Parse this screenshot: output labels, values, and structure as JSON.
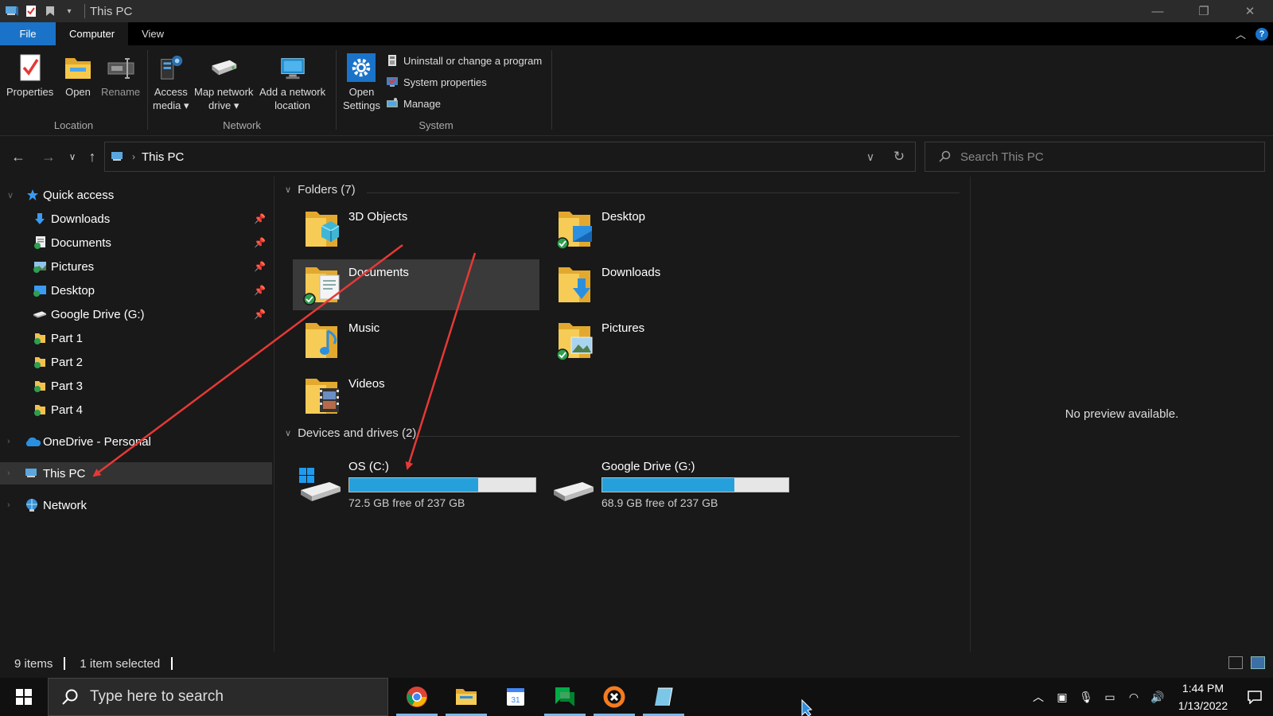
{
  "window": {
    "title": "This PC"
  },
  "ribbon_tabs": [
    {
      "label": "File"
    },
    {
      "label": "Computer"
    },
    {
      "label": "View"
    }
  ],
  "ribbon": {
    "location": {
      "label": "Location",
      "properties": "Properties",
      "open": "Open",
      "rename": "Rename"
    },
    "network": {
      "label": "Network",
      "access_media_1": "Access",
      "access_media_2": "media",
      "map_drive_1": "Map network",
      "map_drive_2": "drive",
      "add_location_1": "Add a network",
      "add_location_2": "location"
    },
    "system": {
      "label": "System",
      "open_settings_1": "Open",
      "open_settings_2": "Settings",
      "uninstall": "Uninstall or change a program",
      "system_properties": "System properties",
      "manage": "Manage"
    }
  },
  "address": {
    "crumb": "This PC",
    "search_placeholder": "Search This PC"
  },
  "nav_pane": {
    "quick_access": "Quick access",
    "quick_items": [
      {
        "label": "Downloads",
        "pinned": true
      },
      {
        "label": "Documents",
        "pinned": true
      },
      {
        "label": "Pictures",
        "pinned": true
      },
      {
        "label": "Desktop",
        "pinned": true
      },
      {
        "label": "Google Drive (G:)",
        "pinned": true
      },
      {
        "label": "Part 1",
        "pinned": false
      },
      {
        "label": "Part 2",
        "pinned": false
      },
      {
        "label": "Part 3",
        "pinned": false
      },
      {
        "label": "Part 4",
        "pinned": false
      }
    ],
    "onedrive": "OneDrive - Personal",
    "this_pc": "This PC",
    "network": "Network"
  },
  "content": {
    "folders_header": "Folders (7)",
    "folders": [
      {
        "label": "3D Objects"
      },
      {
        "label": "Desktop"
      },
      {
        "label": "Documents"
      },
      {
        "label": "Downloads"
      },
      {
        "label": "Music"
      },
      {
        "label": "Pictures"
      },
      {
        "label": "Videos"
      }
    ],
    "drives_header": "Devices and drives (2)",
    "drives": [
      {
        "name": "OS (C:)",
        "free": "72.5 GB free of 237 GB",
        "used_fraction": 0.694
      },
      {
        "name": "Google Drive (G:)",
        "free": "68.9 GB free of 237 GB",
        "used_fraction": 0.709
      }
    ]
  },
  "preview": {
    "text": "No preview available."
  },
  "status": {
    "items": "9 items",
    "selected": "1 item selected"
  },
  "taskbar": {
    "search_placeholder": "Type here to search",
    "time": "1:44 PM",
    "date": "1/13/2022"
  },
  "colors": {
    "accent": "#1a73c9",
    "drive_bar": "#26a0da",
    "annotation_arrow": "#e53935"
  }
}
